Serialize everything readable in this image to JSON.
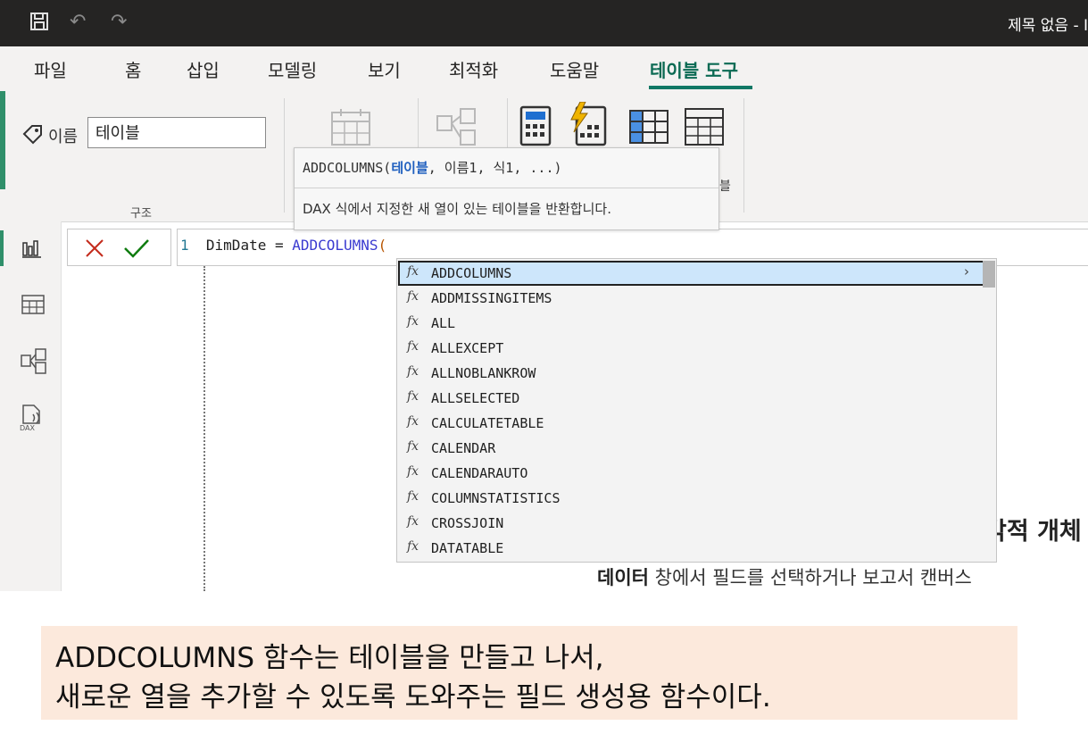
{
  "window": {
    "title": "제목 없음 - I"
  },
  "ribbon_tabs": [
    "파일",
    "홈",
    "삽입",
    "모델링",
    "보기",
    "최적화",
    "도움말",
    "테이블 도구"
  ],
  "ribbon": {
    "name_label": "이름",
    "name_value": "테이블",
    "group_label": "구조"
  },
  "formula": {
    "line_number": "1",
    "text_prefix": "DimDate = ",
    "function": "ADDCOLUMNS",
    "paren": "("
  },
  "tooltip": {
    "sig_fn": "ADDCOLUMNS(",
    "sig_param": "테이블",
    "sig_rest": ", 이름1, 식1, ...)",
    "description": "DAX 식에서 지정한 새 열이 있는 테이블을 반환합니다."
  },
  "autocomplete": {
    "fx_symbol": "fx",
    "items": [
      "ADDCOLUMNS",
      "ADDMISSINGITEMS",
      "ALL",
      "ALLEXCEPT",
      "ALLNOBLANKROW",
      "ALLSELECTED",
      "CALCULATETABLE",
      "CALENDAR",
      "CALENDARAUTO",
      "COLUMNSTATISTICS",
      "CROSSJOIN",
      "DATATABLE"
    ],
    "selected_index": 0
  },
  "background": {
    "heading": "각적 개체",
    "body_bold": "데이터",
    "body_rest": " 창에서 필드를 선택하거나 보고서 캔버스"
  },
  "caption": {
    "line1": "ADDCOLUMNS 함수는 테이블을 만들고 나서,",
    "line2": "새로운 열을 추가할 수 있도록 도와주는 필드 생성용 함수이다."
  },
  "colors": {
    "accent": "#117865",
    "titlebar": "#252423",
    "selected_item": "#cde6fb",
    "caption_bg": "#fce9dc"
  }
}
